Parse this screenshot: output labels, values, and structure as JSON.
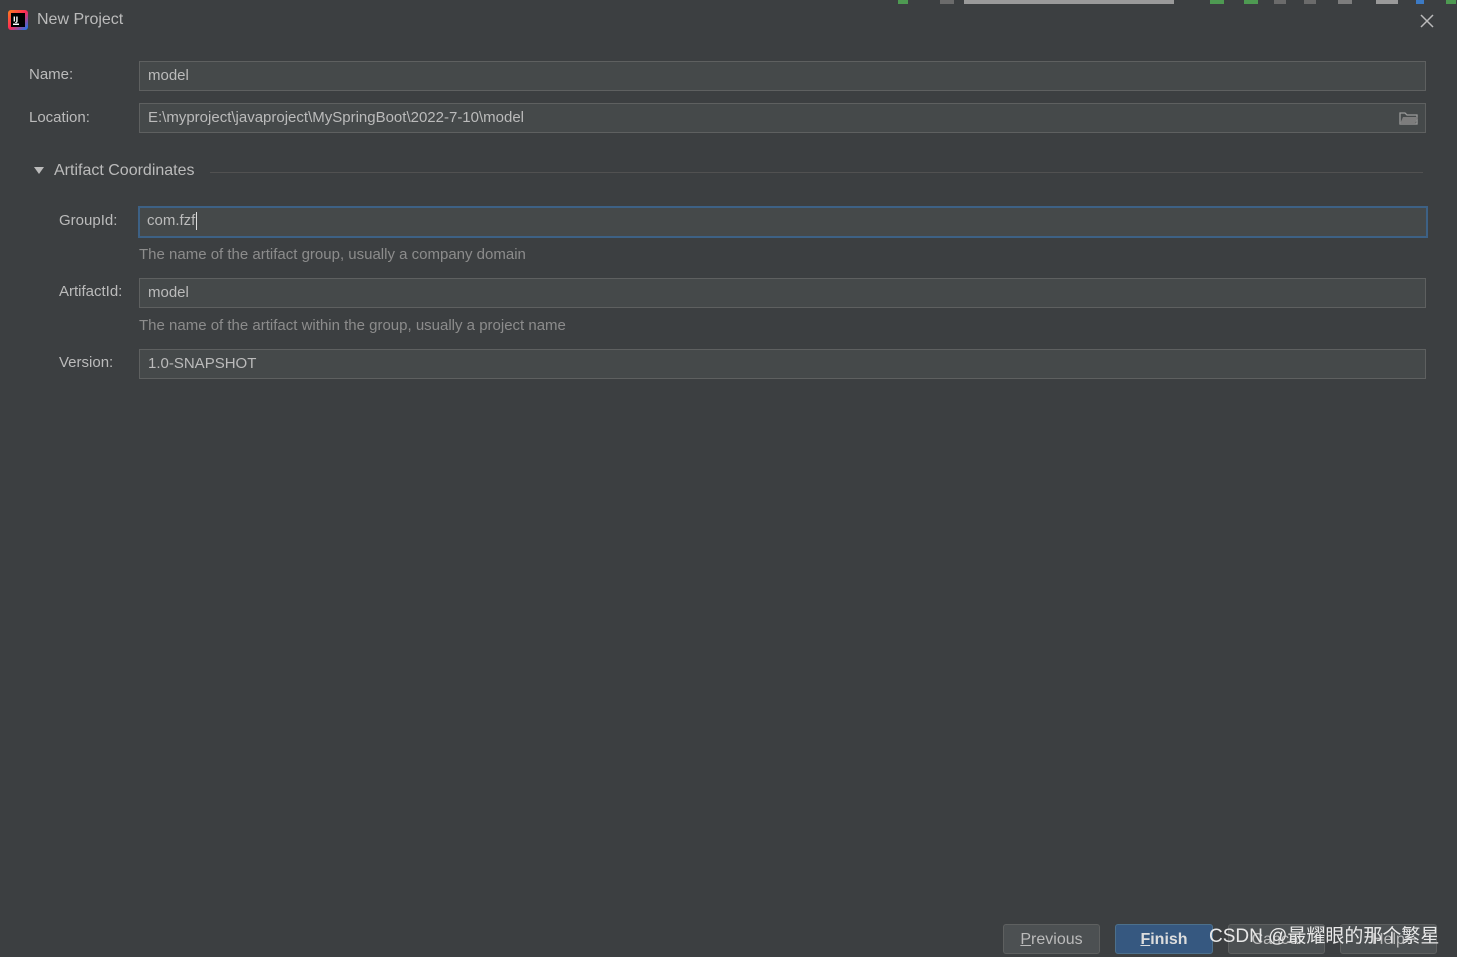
{
  "window": {
    "title": "New Project"
  },
  "form": {
    "name": {
      "label": "Name:",
      "value": "model"
    },
    "location": {
      "label": "Location:",
      "value": "E:\\myproject\\javaproject\\MySpringBoot\\2022-7-10\\model"
    }
  },
  "artifact_section": {
    "title": "Artifact Coordinates",
    "expanded": true,
    "group_id": {
      "label": "GroupId:",
      "value": "com.fzf",
      "hint": "The name of the artifact group, usually a company domain"
    },
    "artifact_id": {
      "label": "ArtifactId:",
      "value": "model",
      "hint": "The name of the artifact within the group, usually a project name"
    },
    "version": {
      "label": "Version:",
      "value": "1.0-SNAPSHOT"
    }
  },
  "buttons": {
    "previous": {
      "mnemonic": "P",
      "rest": "revious"
    },
    "finish": {
      "mnemonic": "F",
      "rest": "inish"
    },
    "cancel": "Cancel",
    "help": "Help"
  },
  "watermark": "CSDN @最耀眼的那个繁星",
  "colors": {
    "background": "#3c3f41",
    "field_bg": "#45494a",
    "focus_border": "#3d6185",
    "primary_button": "#365880"
  }
}
